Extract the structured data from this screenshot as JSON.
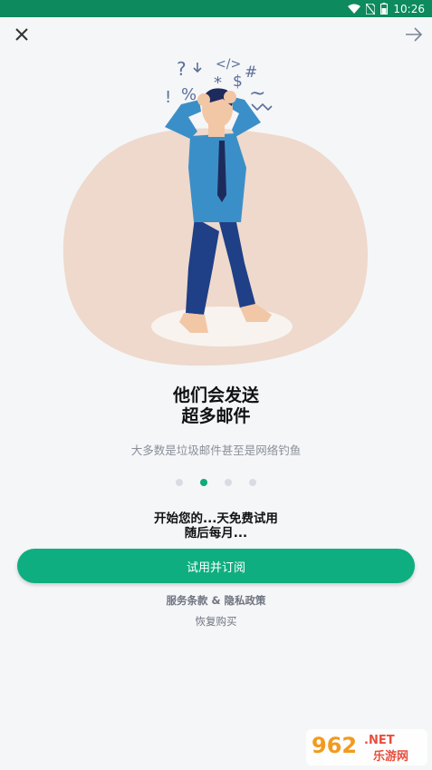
{
  "status_bar": {
    "time": "10:26"
  },
  "slide": {
    "headline_line1": "他们会发送",
    "headline_line2": "超多邮件",
    "subtitle": "大多数是垃圾邮件甚至是网络钓鱼",
    "illustration_symbols": [
      "?",
      "%",
      "!",
      "</>",
      "*",
      "$",
      "#",
      "~"
    ]
  },
  "pager": {
    "count": 4,
    "active_index": 1
  },
  "trial": {
    "line1": "开始您的...天免费试用",
    "line2": "随后每月..."
  },
  "cta_label": "试用并订阅",
  "terms_label": "服务条款 & 隐私政策",
  "restore_label": "恢复购买",
  "watermark": {
    "brand": "962",
    "domain": ".NET",
    "site_name": "乐游网"
  },
  "colors": {
    "accent": "#0fae80",
    "status_bar": "#0d8a5e",
    "blob": "#eed9cc"
  }
}
